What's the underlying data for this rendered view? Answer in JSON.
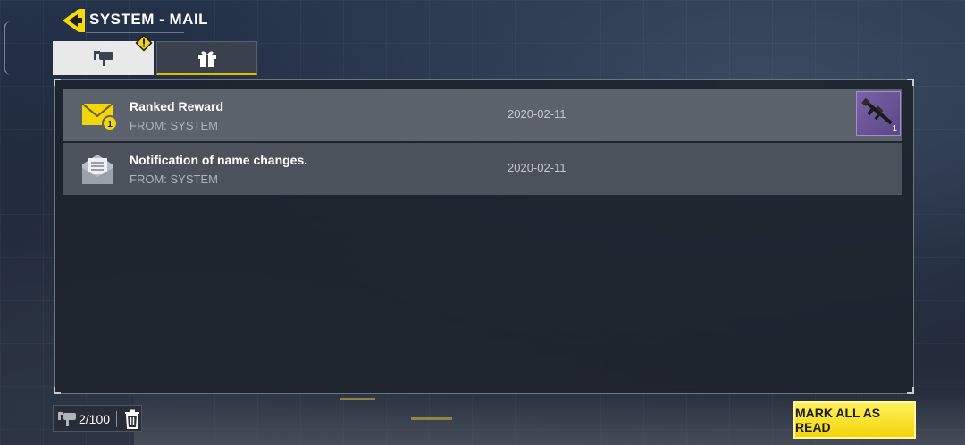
{
  "header": {
    "title": "SYSTEM - MAIL",
    "back_icon": "back-arrow-icon"
  },
  "tabs": [
    {
      "name": "mail",
      "icon": "mailbox-icon",
      "selected": true,
      "alert": true
    },
    {
      "name": "gifts",
      "icon": "gift-icon",
      "selected": false
    }
  ],
  "mails": [
    {
      "title": "Ranked Reward",
      "from": "FROM: SYSTEM",
      "date": "2020-02-11",
      "status": "unread",
      "attachment_count": "1",
      "badge": "1",
      "attachment": {
        "icon": "rifle-icon",
        "count": "1"
      }
    },
    {
      "title": "Notification of name changes.",
      "from": "FROM: SYSTEM",
      "date": "2020-02-11",
      "status": "read"
    }
  ],
  "footer": {
    "mail_count": "2/100",
    "mark_all_label": "MARK ALL AS READ"
  },
  "colors": {
    "accent": "#f2d60b",
    "panel": "#1e232c",
    "row": "#4b525c",
    "row_highlight": "#5b626c"
  }
}
